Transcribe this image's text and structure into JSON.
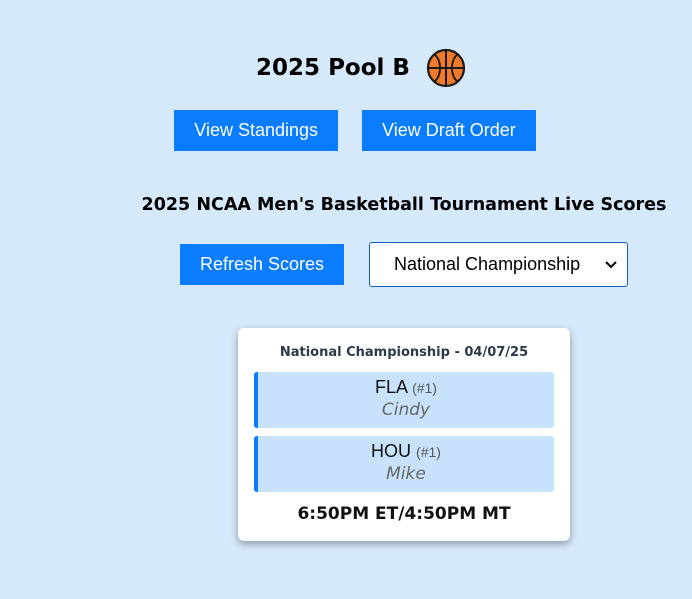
{
  "header": {
    "title": "2025 Pool B",
    "icon": "basketball-icon"
  },
  "nav": {
    "standings_label": "View Standings",
    "draft_order_label": "View Draft Order"
  },
  "scores": {
    "section_title": "2025 NCAA Men's Basketball Tournament Live Scores",
    "refresh_label": "Refresh Scores",
    "round_select": {
      "selected": "National Championship"
    }
  },
  "games": [
    {
      "header": "National Championship - 04/07/25",
      "teams": [
        {
          "abbr": "FLA",
          "seed": "(#1)",
          "owner": "Cindy"
        },
        {
          "abbr": "HOU",
          "seed": "(#1)",
          "owner": "Mike"
        }
      ],
      "time": "6:50PM ET/4:50PM MT"
    }
  ],
  "colors": {
    "background": "#d6e9fb",
    "button": "#0a7cff",
    "team_box": "#c8e2fb",
    "basketball": "#f07a2c"
  }
}
